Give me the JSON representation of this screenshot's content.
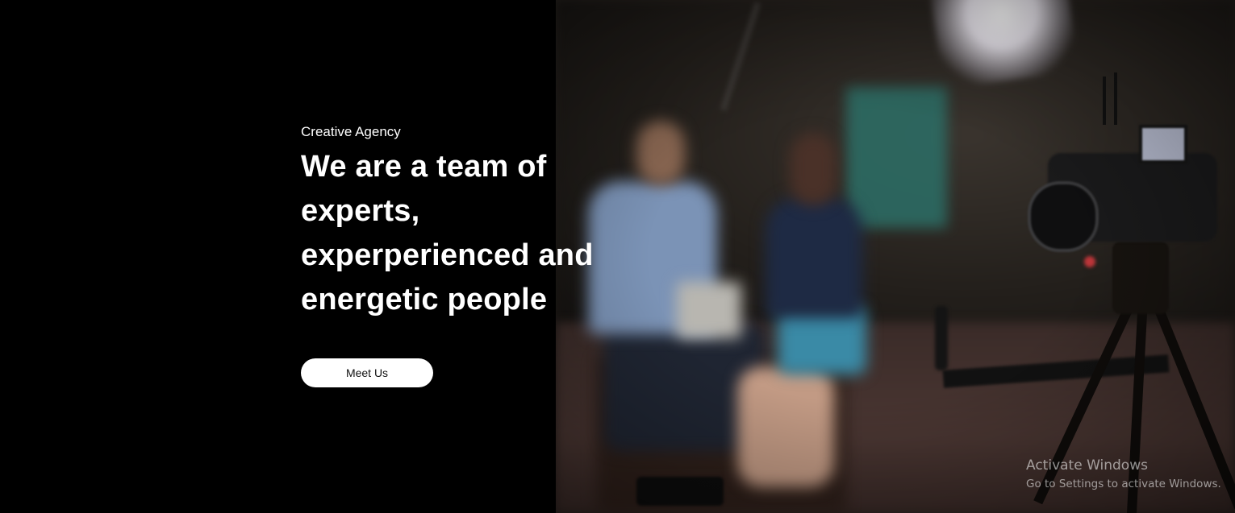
{
  "hero": {
    "eyebrow": "Creative Agency",
    "headline": "We are a team of experts, experperienced and energetic people",
    "cta_label": "Meet Us",
    "background_color": "#000000",
    "cta_background": "#ffffff",
    "photo_subject": "film-set-interview-photo"
  },
  "os_watermark": {
    "title": "Activate Windows",
    "subtitle": "Go to Settings to activate Windows."
  }
}
